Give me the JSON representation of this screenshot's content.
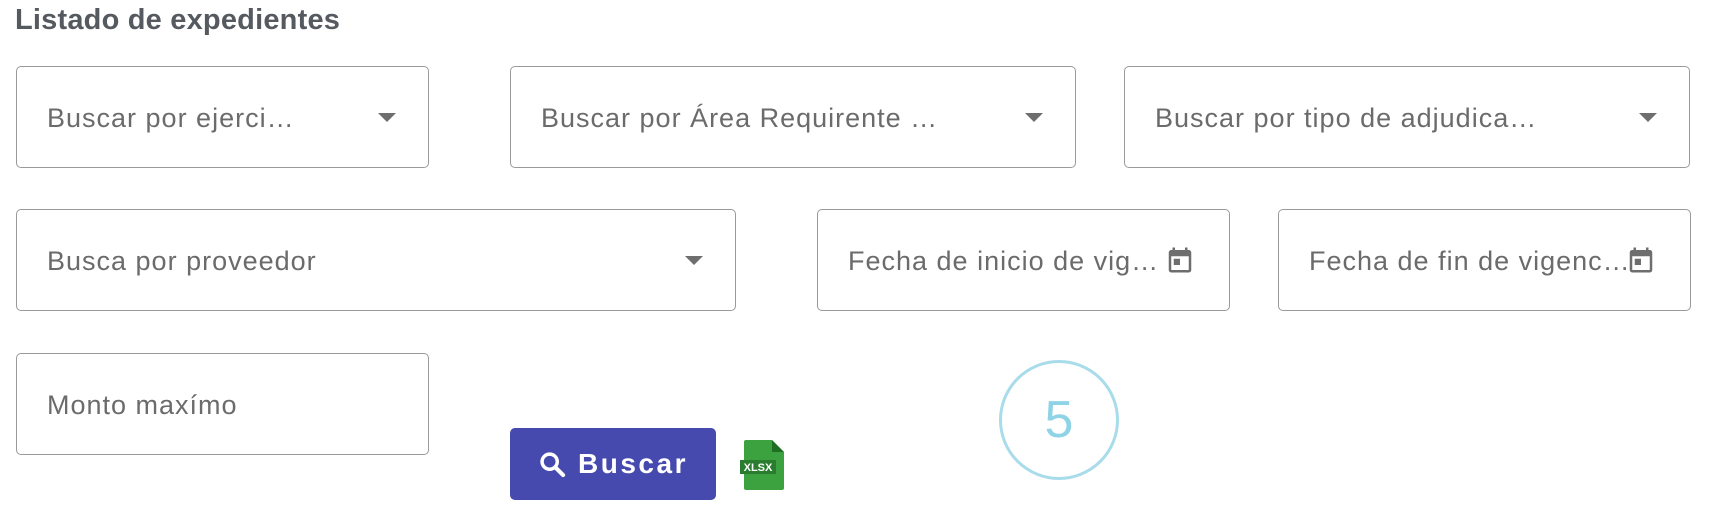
{
  "page": {
    "title": "Listado de expedientes"
  },
  "filters": {
    "ejercicio": {
      "placeholder": "Buscar por ejerci…",
      "icon": "chevron-down-icon"
    },
    "area_requirente": {
      "placeholder": "Buscar por Área Requirente …",
      "icon": "chevron-down-icon"
    },
    "tipo_adjudicacion": {
      "placeholder": "Buscar por tipo de adjudica…",
      "icon": "chevron-down-icon"
    },
    "proveedor": {
      "placeholder": "Busca por proveedor",
      "icon": "chevron-down-icon"
    },
    "fecha_inicio": {
      "placeholder": "Fecha de inicio de vig…",
      "icon": "calendar-icon"
    },
    "fecha_fin": {
      "placeholder": "Fecha de fin de vigenc…",
      "icon": "calendar-icon"
    },
    "monto_maximo": {
      "placeholder": "Monto maxímo"
    }
  },
  "actions": {
    "search_label": "Buscar",
    "search_icon": "search-icon",
    "export_label": "XLSX",
    "export_icon": "xlsx-file-icon"
  },
  "overlay": {
    "step_number": "5"
  },
  "colors": {
    "primary": "#4649ad",
    "excel_green": "#3ca13f",
    "step_circle": "#a8dcea",
    "title_text": "#555a60",
    "field_border": "#9a9a9a",
    "field_text": "#6b6b6b"
  }
}
